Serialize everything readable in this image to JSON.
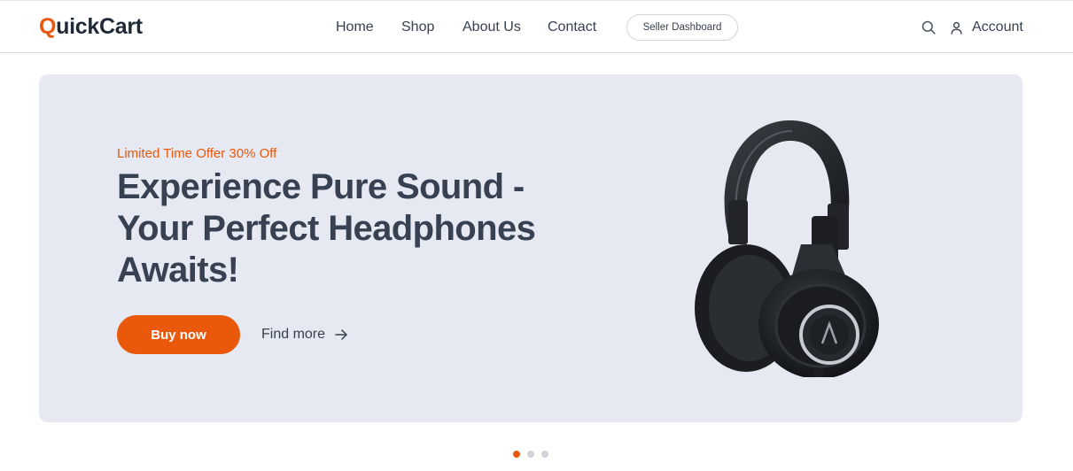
{
  "brand": {
    "first_letter": "Q",
    "rest": "uickCart",
    "accent_color": "#ea580c"
  },
  "nav": {
    "links": [
      "Home",
      "Shop",
      "About Us",
      "Contact"
    ],
    "seller_button": "Seller Dashboard",
    "search_icon": "search-icon",
    "account_icon": "user-icon",
    "account_label": "Account"
  },
  "hero": {
    "offer": "Limited Time Offer 30% Off",
    "headline_lines": [
      "Experience Pure Sound -",
      "Your Perfect Headphones",
      "Awaits!"
    ],
    "primary_cta": "Buy now",
    "secondary_cta": "Find more",
    "secondary_icon": "arrow-right-icon",
    "image": "headphones-image",
    "background_color": "#e6e9f2"
  },
  "carousel": {
    "slides": 3,
    "active_index": 0
  }
}
